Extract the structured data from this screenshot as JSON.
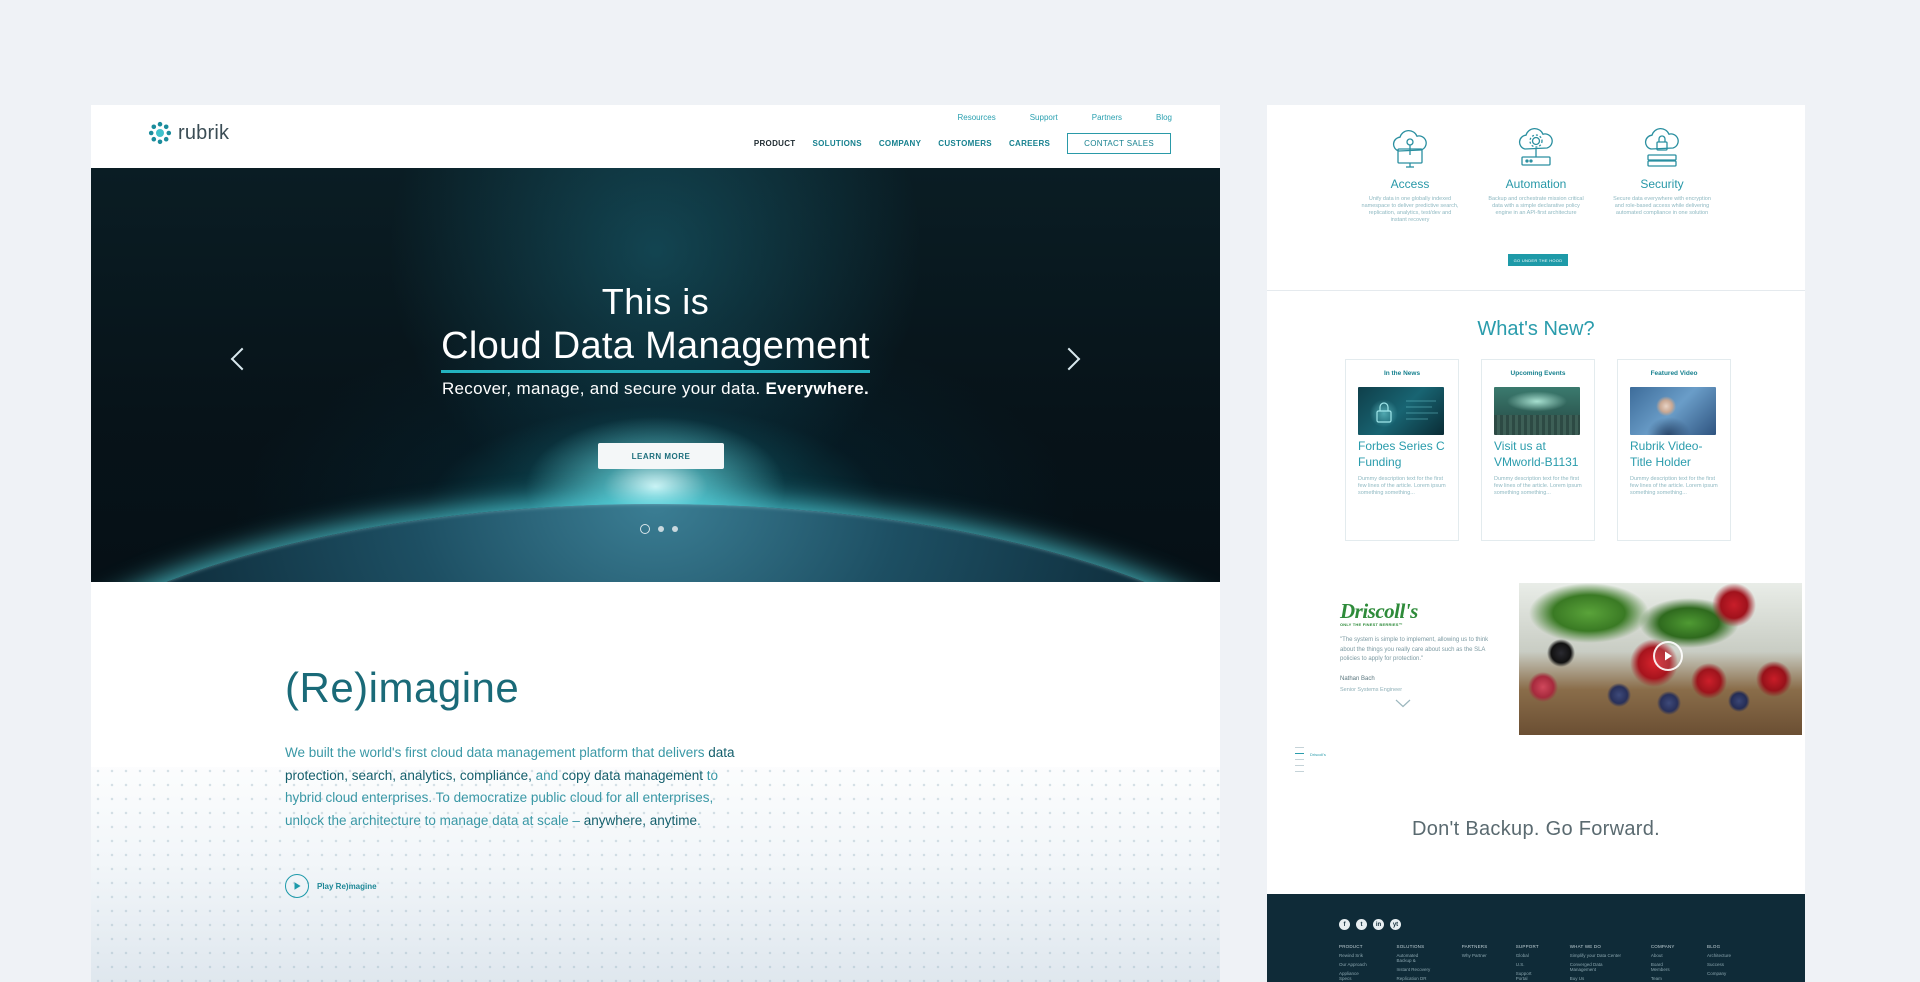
{
  "main": {
    "logo_text": "rubrik",
    "top_links": [
      "Resources",
      "Support",
      "Partners",
      "Blog"
    ],
    "nav": [
      "PRODUCT",
      "SOLUTIONS",
      "COMPANY",
      "CUSTOMERS",
      "CAREERS"
    ],
    "contact_label": "CONTACT SALES",
    "hero": {
      "line1": "This is",
      "line2": "Cloud Data Management",
      "sub_plain": "Recover, manage, and secure your data.",
      "sub_bold": "Everywhere.",
      "cta": "LEARN MORE",
      "slides": 3,
      "active_slide": 1
    },
    "reimagine": {
      "title": "(Re)imagine",
      "body": [
        {
          "t": "We built the world's first cloud data management platform that delivers ",
          "b": false
        },
        {
          "t": "data protection, search, analytics, compliance,",
          "b": true
        },
        {
          "t": " and ",
          "b": false
        },
        {
          "t": "copy data management",
          "b": true
        },
        {
          "t": " to hybrid cloud enterprises. To democratize public cloud for all enterprises, unlock the architecture to manage data at scale – ",
          "b": false
        },
        {
          "t": "anywhere, anytime",
          "b": true
        },
        {
          "t": ".",
          "b": false
        }
      ],
      "play_label": "Play Re)magine"
    }
  },
  "side": {
    "features": [
      {
        "title": "Access",
        "desc": "Unify data in one globally indexed namespace to deliver predictive search, replication, analytics, test/dev and instant recovery",
        "icon": "cloud-access-icon"
      },
      {
        "title": "Automation",
        "desc": "Backup and orchestrate mission critical data with a simple declarative policy engine in an API-first architecture",
        "icon": "cloud-automation-icon"
      },
      {
        "title": "Security",
        "desc": "Secure data everywhere with encryption and role-based access while delivering automated compliance in one solution",
        "icon": "cloud-security-icon"
      }
    ],
    "features_button": "GO UNDER THE HOOD",
    "whats_new_title": "What's New?",
    "news": [
      {
        "category": "In the News",
        "title": "Forbes Series C Funding",
        "desc": "Dummy description text for the first few lines of the article. Lorem ipsum something something..."
      },
      {
        "category": "Upcoming Events",
        "title": "Visit us at VMworld-B1131",
        "desc": "Dummy description text for the first few lines of the article. Lorem ipsum something something..."
      },
      {
        "category": "Featured Video",
        "title": "Rubrik Video-Title Holder",
        "desc": "Dummy description text for the first few lines of the article. Lorem ipsum something something..."
      }
    ],
    "testimonial": {
      "brand": "Driscoll's",
      "brand_tag": "ONLY THE FINEST BERRIES™",
      "quote": "\"The system is simple to implement, allowing us to think about the things you really care about such as the SLA policies to apply for protection.\"",
      "name": "Nathan Bach",
      "role": "Senior Systems Engineer"
    },
    "mini_nav_label": "Driscoll's",
    "tagline": "Don't Backup. Go Forward.",
    "footer": {
      "social": [
        "f",
        "t",
        "in",
        "yt"
      ],
      "columns": [
        {
          "head": "PRODUCT",
          "links": [
            "Rewind Srik",
            "Our Approach",
            "Appliance Specs"
          ]
        },
        {
          "head": "SOLUTIONS",
          "links": [
            "Automated Backup &",
            "Instant Recovery",
            "Replication DR"
          ]
        },
        {
          "head": "PARTNERS",
          "links": [
            "Why Partner"
          ]
        },
        {
          "head": "SUPPORT",
          "links": [
            "Global",
            "U.S.",
            "Support Portal"
          ]
        },
        {
          "head": "WHAT WE DO",
          "links": [
            "Simplify your Data Center",
            "Converged Data Management",
            "Buy Us"
          ]
        },
        {
          "head": "COMPANY",
          "links": [
            "About",
            "Board Members",
            "Team"
          ]
        },
        {
          "head": "BLOG",
          "links": [
            "Architecture",
            "Success",
            "Company"
          ]
        }
      ]
    }
  },
  "colors": {
    "brand_teal": "#1d8796",
    "accent": "#23b3c0",
    "footer_bg": "#0f2b38",
    "driscolls_green": "#2e8b3a"
  }
}
